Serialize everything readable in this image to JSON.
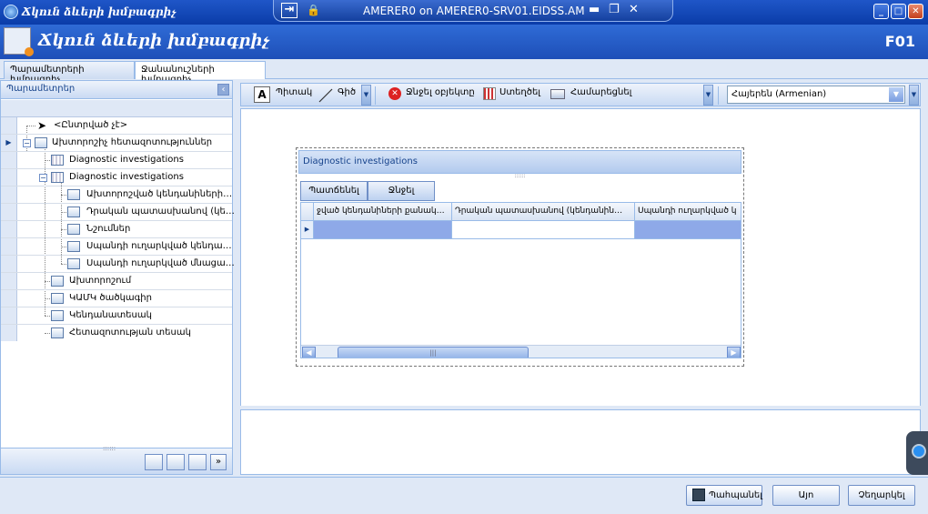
{
  "window": {
    "title": "Ճկուն ձևերի խմբագրիչ",
    "connection": "AMERER0 on AMERER0-SRV01.EIDSS.AM"
  },
  "header": {
    "title": "Ճկուն ձևերի խմբագրիչ",
    "code": "F01"
  },
  "tabs": [
    {
      "label": "Պարամետրերի խմբագրիչ"
    },
    {
      "label": "Ջանանուշների խմբագրիչ"
    }
  ],
  "left_panel": {
    "title": "Պարամետրեր",
    "tree": [
      {
        "label": "<Ընտրված չէ>"
      },
      {
        "label": "Ախտորոշիչ հետազոտություններ"
      },
      {
        "label": "Diagnostic investigations"
      },
      {
        "label": "Diagnostic investigations"
      },
      {
        "label": "Ախտորոշված կենդանիների…"
      },
      {
        "label": "Դրական պատասխանով (կե…"
      },
      {
        "label": "Նշումներ"
      },
      {
        "label": "Սպանդի ուղարկված կենդա…"
      },
      {
        "label": "Սպանդի ուղարկված մնացա…"
      },
      {
        "label": "Ախտորոշում"
      },
      {
        "label": "ԿԱՄԿ ծածկագիր"
      },
      {
        "label": "Կենդանատեսակ"
      },
      {
        "label": "Հետազոտության տեսակ"
      }
    ]
  },
  "toolbar": {
    "text_label": "Պիտակ",
    "line_label": "Գիծ",
    "delete_label": "Ջնջել օբյեկտը",
    "create_label": "Ստեղծել",
    "align_label": "Համարեցնել",
    "language": "Հայերեն (Armenian)"
  },
  "designer": {
    "section_title": "Diagnostic investigations",
    "add_label": "Պատճենել",
    "delete_label": "Ջնջել",
    "columns": [
      "ջված կենդանիների քանակ…",
      "Դրական պատասխանով (կենդանին…",
      "Սպանդի ուղարկված կ"
    ]
  },
  "footer": {
    "save_label": "Պահպանել",
    "ok_label": "Այո",
    "cancel_label": "Չեղարկել"
  },
  "colors": {
    "accent": "#1e4fb8",
    "panel_bg": "#dfe8f6",
    "border": "#99bbe8",
    "selection": "#8ea9e8"
  }
}
